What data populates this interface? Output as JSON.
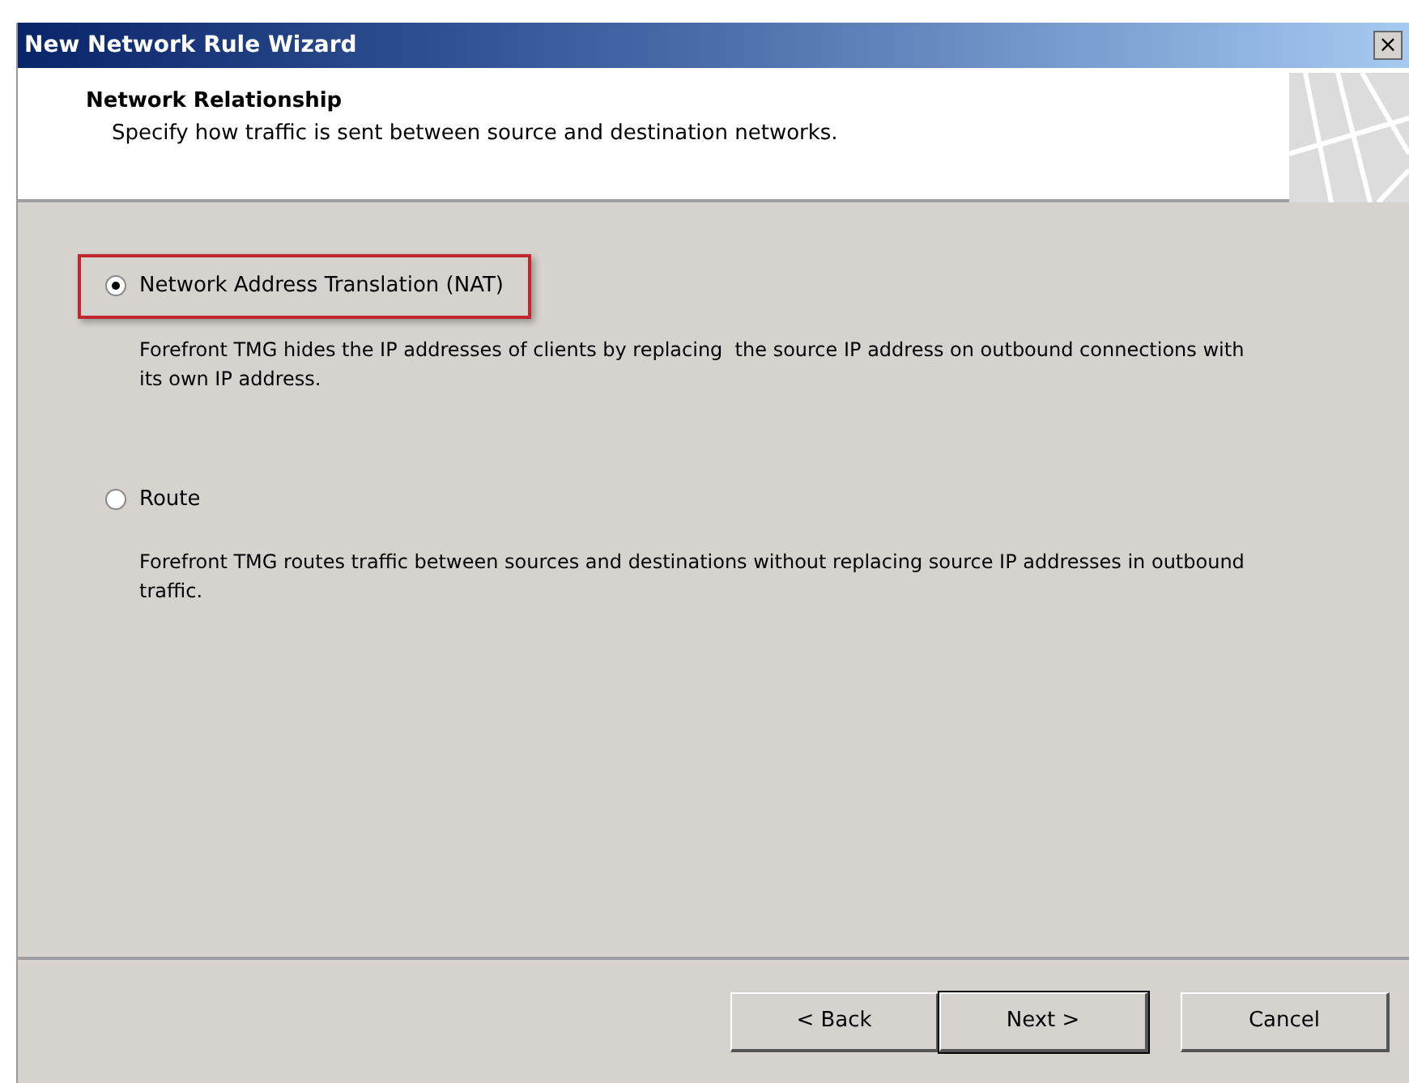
{
  "window": {
    "title": "New Network Rule Wizard",
    "close": "×"
  },
  "header": {
    "title": "Network Relationship",
    "subtitle": "Specify how traffic is sent between source and destination networks."
  },
  "options": [
    {
      "label": "Network Address Translation (NAT)",
      "selected": true,
      "highlighted": true,
      "description": "Forefront TMG hides the IP addresses of clients by replacing  the source IP address on outbound connections with its own IP address."
    },
    {
      "label": "Route",
      "selected": false,
      "highlighted": false,
      "description": "Forefront TMG routes traffic between sources and destinations without replacing source IP addresses in outbound traffic."
    }
  ],
  "buttons": [
    {
      "label": "< Back",
      "default": false
    },
    {
      "label": "Next >",
      "default": true
    },
    {
      "label": "Cancel",
      "default": false
    }
  ]
}
